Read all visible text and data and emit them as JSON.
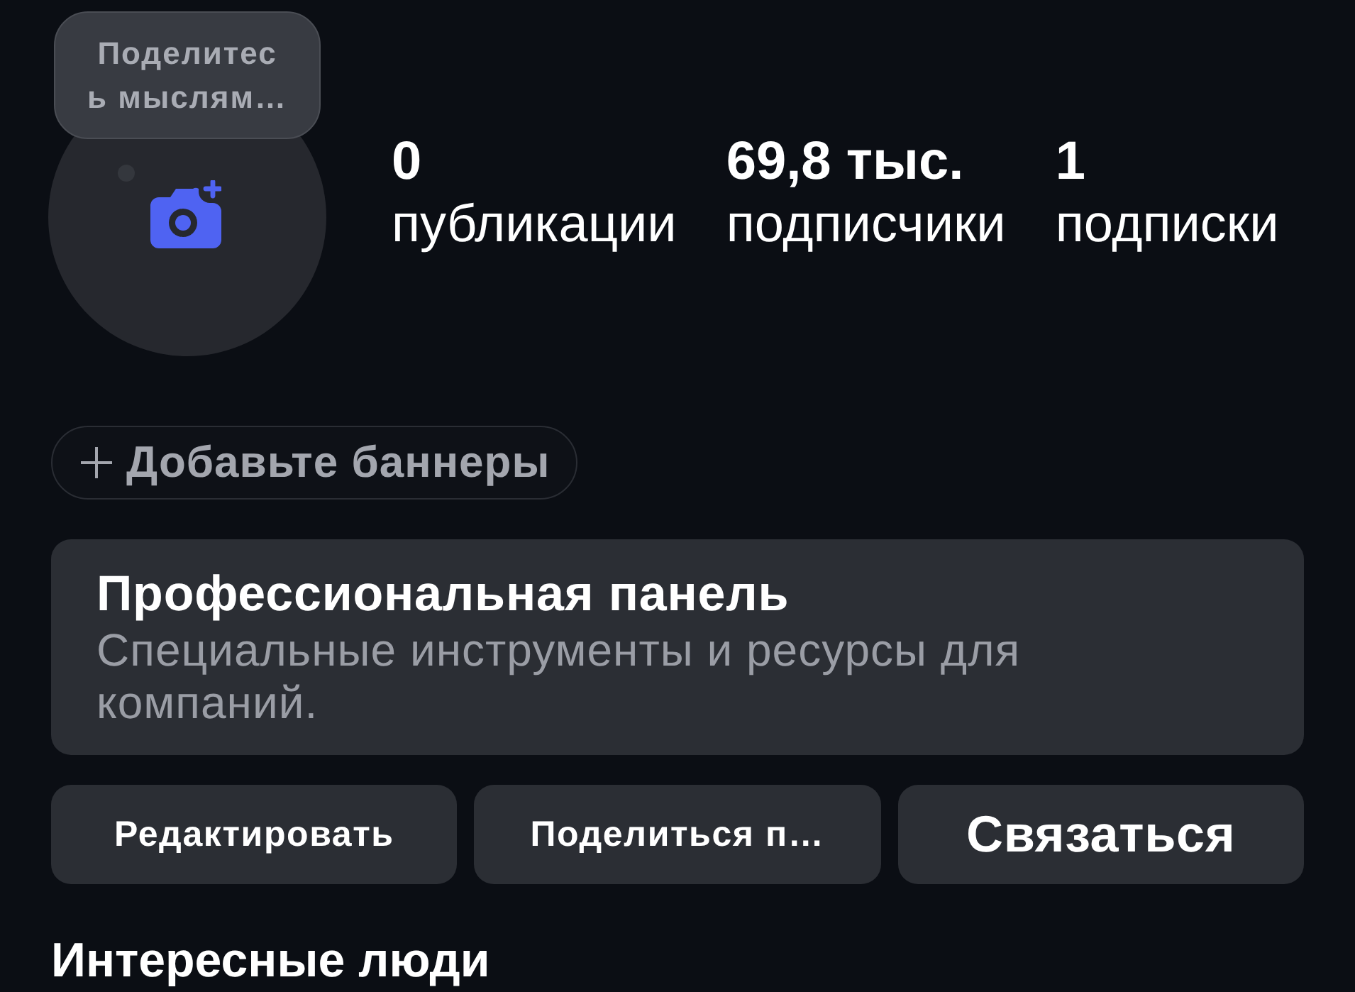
{
  "profile": {
    "thought_bubble": {
      "text": "Поделитес\nь мыслям…"
    },
    "stats": [
      {
        "value": "0",
        "label": "публикации"
      },
      {
        "value": "69,8 тыс.",
        "label": "подписчики"
      },
      {
        "value": "1",
        "label": "подписки"
      }
    ]
  },
  "banner_button": {
    "label": "Добавьте баннеры"
  },
  "pro_panel": {
    "title": "Профессиональная панель",
    "subtitle": "Специальные инструменты и ресурсы для компаний."
  },
  "actions": [
    {
      "label": "Редактировать",
      "kind": "small"
    },
    {
      "label": "Поделиться п…",
      "kind": "small"
    },
    {
      "label": "Связаться",
      "kind": "large"
    }
  ],
  "section_heading": "Интересные люди"
}
